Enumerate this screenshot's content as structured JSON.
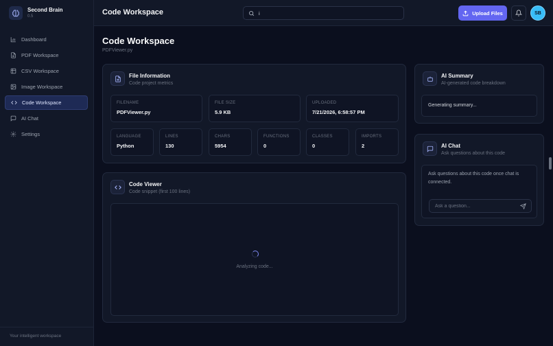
{
  "brand": {
    "name": "Second Brain",
    "version": "0.5"
  },
  "nav": [
    {
      "label": "Dashboard",
      "icon": "bar-chart-icon"
    },
    {
      "label": "PDF Workspace",
      "icon": "file-icon"
    },
    {
      "label": "CSV Workspace",
      "icon": "table-icon"
    },
    {
      "label": "Image Workspace",
      "icon": "image-icon"
    },
    {
      "label": "Code Workspace",
      "icon": "code-icon",
      "active": true
    },
    {
      "label": "AI Chat",
      "icon": "chat-icon"
    },
    {
      "label": "Settings",
      "icon": "gear-icon"
    }
  ],
  "sidebar_footer": "Your intelligent workspace",
  "topbar": {
    "title": "Code Workspace",
    "search_value": "i",
    "upload_label": "Upload Files",
    "avatar_initials": "SB"
  },
  "page": {
    "title": "Code Workspace",
    "subtitle": "PDFViewer.py"
  },
  "file_info": {
    "title": "File Information",
    "subtitle": "Code project metrics",
    "stats_top": [
      {
        "label": "FILENAME",
        "value": "PDFViewer.py"
      },
      {
        "label": "FILE SIZE",
        "value": "5.9 KB"
      },
      {
        "label": "UPLOADED",
        "value": "7/21/2026, 6:58:57 PM"
      }
    ],
    "stats_bottom": [
      {
        "label": "LANGUAGE",
        "value": "Python"
      },
      {
        "label": "LINES",
        "value": "130"
      },
      {
        "label": "CHARS",
        "value": "5954"
      },
      {
        "label": "FUNCTIONS",
        "value": "0"
      },
      {
        "label": "CLASSES",
        "value": "0"
      },
      {
        "label": "IMPORTS",
        "value": "2"
      }
    ]
  },
  "code_viewer": {
    "title": "Code Viewer",
    "subtitle": "Code snippet (first 100 lines)",
    "status": "Analyzing code..."
  },
  "ai_summary": {
    "title": "AI Summary",
    "subtitle": "AI-generated code breakdown",
    "status": "Generating summary..."
  },
  "ai_chat": {
    "title": "AI Chat",
    "subtitle": "Ask questions about this code",
    "message": "Ask questions about this code once chat is connected.",
    "input_placeholder": "Ask a question..."
  },
  "colors": {
    "accent": "#6366f1",
    "background": "#0b0f1e",
    "card": "#121828",
    "avatar": "#38bdf8"
  }
}
